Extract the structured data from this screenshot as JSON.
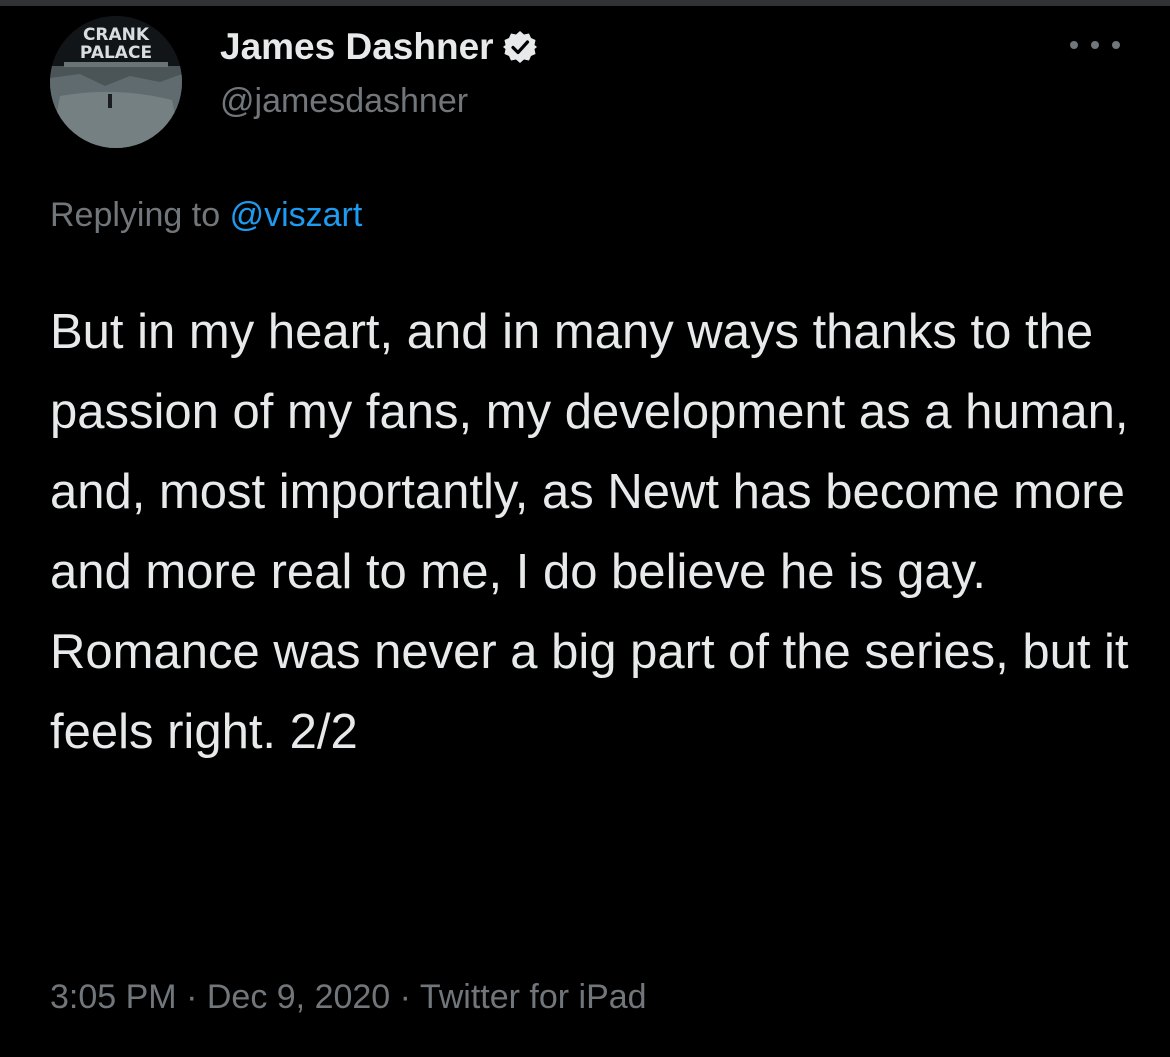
{
  "tweet": {
    "author": {
      "display_name": "James Dashner",
      "handle": "@jamesdashner",
      "verified": true,
      "avatar_text_line1": "CRANK",
      "avatar_text_line2": "PALACE"
    },
    "replying_prefix": "Replying to",
    "replying_to": "@viszart",
    "text": "But in my heart, and in many ways thanks to the passion of my fans, my development as a human, and, most importantly, as Newt has become more and more real to me, I do believe he is gay. Romance was never a big part of the series, but it feels right. 2/2",
    "time": "3:05 PM",
    "separator": "·",
    "date": "Dec 9, 2020",
    "source": "Twitter for iPad"
  },
  "icons": {
    "verified": "verified-badge-icon",
    "more": "more-options-icon"
  },
  "colors": {
    "background": "#000000",
    "text": "#e7e9ea",
    "secondary": "#71767b",
    "link": "#1d9bf0"
  }
}
